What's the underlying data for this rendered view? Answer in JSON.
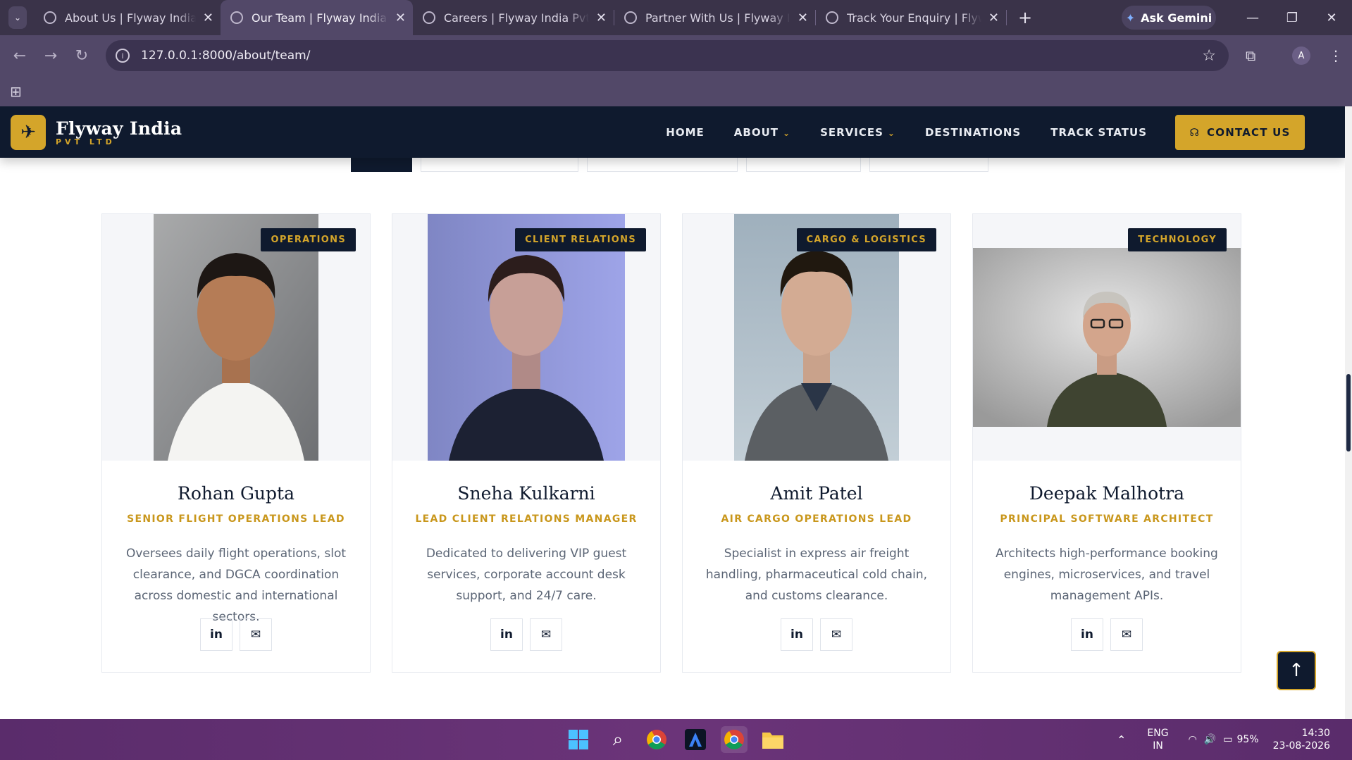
{
  "browser": {
    "tabs": [
      {
        "title": "About Us | Flyway India Pvt Ltd",
        "active": false
      },
      {
        "title": "Our Team | Flyway India Pvt Ltd",
        "active": true
      },
      {
        "title": "Careers | Flyway India Pvt Ltd",
        "active": false
      },
      {
        "title": "Partner With Us | Flyway India",
        "active": false
      },
      {
        "title": "Track Your Enquiry | Flyway India",
        "active": false
      }
    ],
    "gemini_label": "Ask Gemini",
    "url": "127.0.0.1:8000/about/team/",
    "profile_initial": "A"
  },
  "site": {
    "brand_name": "Flyway India",
    "brand_sub": "PVT LTD",
    "nav": [
      "HOME",
      "ABOUT",
      "SERVICES",
      "DESTINATIONS",
      "TRACK STATUS"
    ],
    "contact_label": "CONTACT US"
  },
  "team": [
    {
      "department": "OPERATIONS",
      "name": "Rohan Gupta",
      "role": "SENIOR FLIGHT OPERATIONS LEAD",
      "bio": "Oversees daily flight operations, slot clearance, and DGCA coordination across domestic and international sectors."
    },
    {
      "department": "CLIENT RELATIONS",
      "name": "Sneha Kulkarni",
      "role": "LEAD CLIENT RELATIONS MANAGER",
      "bio": "Dedicated to delivering VIP guest services, corporate account desk support, and 24/7 care."
    },
    {
      "department": "CARGO & LOGISTICS",
      "name": "Amit Patel",
      "role": "AIR CARGO OPERATIONS LEAD",
      "bio": "Specialist in express air freight handling, pharmaceutical cold chain, and customs clearance."
    },
    {
      "department": "TECHNOLOGY",
      "name": "Deepak Malhotra",
      "role": "PRINCIPAL SOFTWARE ARCHITECT",
      "bio": "Architects high-performance booking engines, microservices, and travel management APIs."
    }
  ],
  "taskbar": {
    "lang": "ENG",
    "region": "IN",
    "battery": "95%",
    "time": "14:30",
    "date": "23-08-2026"
  },
  "colors": {
    "navy": "#0f1a2e",
    "gold": "#d4a52a",
    "role_gold": "#c9971c"
  }
}
